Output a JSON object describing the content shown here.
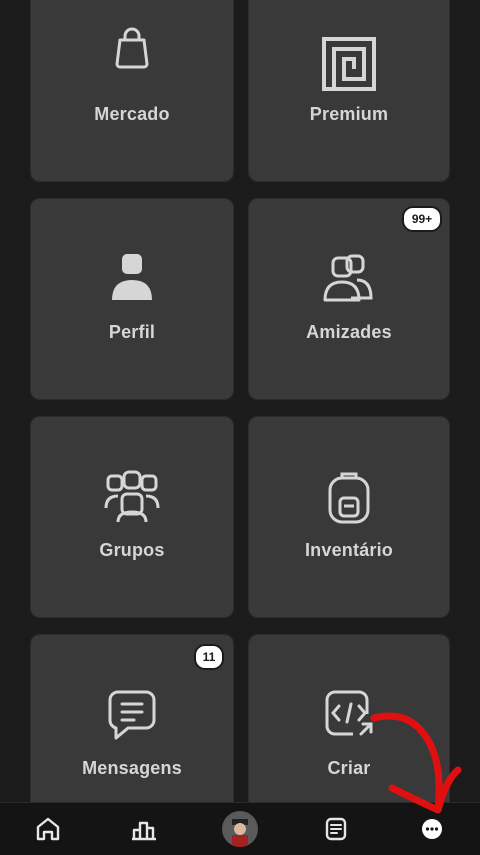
{
  "tiles": {
    "mercado": {
      "label": "Mercado",
      "icon": "shopping-bag-icon"
    },
    "premium": {
      "label": "Premium",
      "icon": "premium-icon"
    },
    "perfil": {
      "label": "Perfil",
      "icon": "profile-icon"
    },
    "amizades": {
      "label": "Amizades",
      "icon": "friends-icon",
      "badge": "99+"
    },
    "grupos": {
      "label": "Grupos",
      "icon": "groups-icon"
    },
    "inventario": {
      "label": "Inventário",
      "icon": "backpack-icon"
    },
    "mensagens": {
      "label": "Mensagens",
      "icon": "message-icon",
      "badge": "11"
    },
    "criar": {
      "label": "Criar",
      "icon": "code-icon"
    }
  },
  "navbar": {
    "items": [
      "home-icon",
      "charts-icon",
      "avatar",
      "feed-icon",
      "more-icon"
    ]
  },
  "colors": {
    "tile": "#393939",
    "background": "#1b1b1b",
    "text": "#d6d6d6",
    "annotation": "#e01010"
  }
}
